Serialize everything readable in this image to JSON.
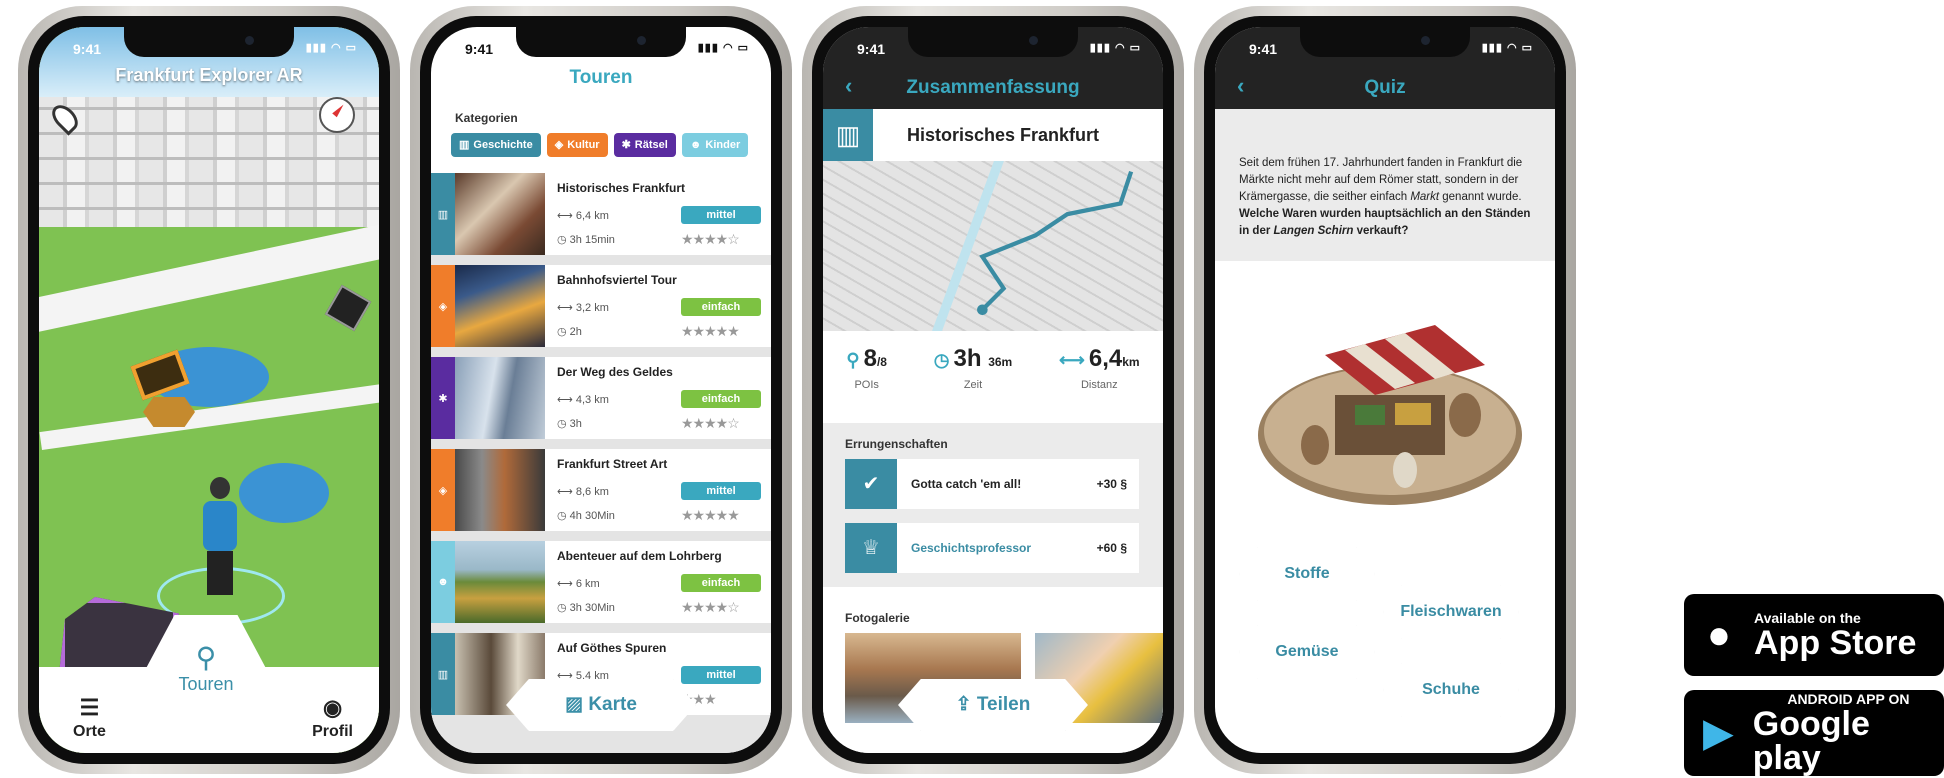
{
  "status": {
    "time": "9:41"
  },
  "phone1": {
    "title": "Frankfurt Explorer AR",
    "tabs": {
      "left": "Orte",
      "center": "Touren",
      "right": "Profil"
    }
  },
  "phone2": {
    "header": "Touren",
    "categories_label": "Kategorien",
    "chips": [
      "Geschichte",
      "Kultur",
      "Rätsel",
      "Kinder"
    ],
    "tours": [
      {
        "name": "Historisches Frankfurt",
        "distance": "6,4 km",
        "duration": "3h 15min",
        "level": "mittel",
        "stars": "★★★★☆"
      },
      {
        "name": "Bahnhofsviertel Tour",
        "distance": "3,2 km",
        "duration": "2h",
        "level": "einfach",
        "stars": "★★★★★"
      },
      {
        "name": "Der Weg des Geldes",
        "distance": "4,3 km",
        "duration": "3h",
        "level": "einfach",
        "stars": "★★★★☆"
      },
      {
        "name": "Frankfurt Street Art",
        "distance": "8,6 km",
        "duration": "4h 30Min",
        "level": "mittel",
        "stars": "★★★★★"
      },
      {
        "name": "Abenteuer auf dem Lohrberg",
        "distance": "6 km",
        "duration": "3h 30Min",
        "level": "einfach",
        "stars": "★★★★☆"
      },
      {
        "name": "Auf Göthes Spuren",
        "distance": "5,4 km",
        "duration": "",
        "level": "mittel",
        "stars": "★★★"
      }
    ],
    "map_button": "Karte"
  },
  "phone3": {
    "header": "Zusammenfassung",
    "tour_title": "Historisches Frankfurt",
    "stats": [
      {
        "value": "8",
        "unit": "/8",
        "label": "POIs"
      },
      {
        "value": "3h",
        "unit": "36m",
        "label": "Zeit"
      },
      {
        "value": "6,4",
        "unit": "km",
        "label": "Distanz"
      }
    ],
    "achievements_label": "Errungenschaften",
    "achievements": [
      {
        "name": "Gotta catch 'em all!",
        "points": "+30"
      },
      {
        "name": "Geschichtsprofessor",
        "points": "+60"
      }
    ],
    "gallery_label": "Fotogalerie",
    "share_button": "Teilen"
  },
  "phone4": {
    "header": "Quiz",
    "question_p1": "Seit dem frühen 17. Jahrhundert fanden in Frankfurt die Märkte nicht mehr auf dem Römer statt, sondern in der Krämergasse, die seither einfach ",
    "question_em": "Markt",
    "question_p2": " genannt wurde. ",
    "question_bold1": "Welche Waren wurden hauptsächlich an den Ständen in der ",
    "question_bold_em": "Langen Schirn",
    "question_bold2": " verkauft?",
    "answers": [
      "Stoffe",
      "Fleischwaren",
      "Gemüse",
      "Schuhe"
    ]
  },
  "stores": {
    "apple_small": "Available on the",
    "apple_big": "App Store",
    "google_small": "ANDROID APP ON",
    "google_big": "Google play"
  },
  "colors": {
    "teal": "#3aa8bf",
    "dark_teal": "#3a8ca3",
    "green": "#7dc242",
    "orange": "#f07d2a",
    "purple": "#5a2ca0",
    "light_blue": "#7ccde0"
  }
}
